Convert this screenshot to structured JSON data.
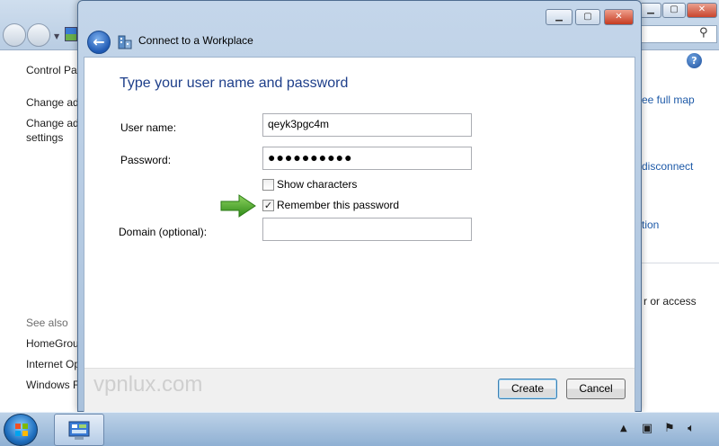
{
  "background_window": {
    "left_pane": {
      "items": [
        "Control Pa",
        "Change ad",
        "Change ad",
        "settings"
      ],
      "see_also_label": "See also",
      "see_also_items": [
        "HomeGrou",
        "Internet Op",
        "Windows F"
      ]
    },
    "right_pane": {
      "links": [
        "ee full map",
        "disconnect",
        "tion",
        "r or access"
      ]
    }
  },
  "dialog": {
    "title": "Connect to a Workplace",
    "heading": "Type your user name and password",
    "fields": {
      "username_label": "User name:",
      "username_value": "qeyk3pgc4m",
      "password_label": "Password:",
      "password_value": "●●●●●●●●●●",
      "domain_label": "Domain (optional):",
      "domain_value": ""
    },
    "checkboxes": {
      "show_characters": {
        "label": "Show characters",
        "checked": false
      },
      "remember_password": {
        "label": "Remember this password",
        "checked": true
      }
    },
    "buttons": {
      "create": "Create",
      "cancel": "Cancel"
    },
    "watermark": "vpnlux.com"
  },
  "icons": {
    "back": "back-arrow-icon",
    "workplace": "network-workplace-icon",
    "arrow": "green-arrow-icon",
    "start": "windows-start-icon"
  },
  "colors": {
    "heading": "#1e3f8a",
    "link": "#1e5aa8",
    "arrow": "#4aa52a"
  }
}
